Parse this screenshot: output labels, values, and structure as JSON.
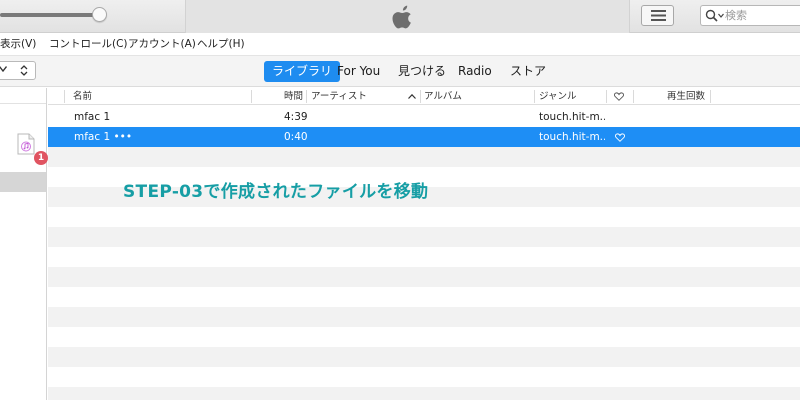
{
  "search": {
    "placeholder": "検索"
  },
  "menu": [
    {
      "label": "表示(V)"
    },
    {
      "label": "コントロール(C)"
    },
    {
      "label": "アカウント(A)"
    },
    {
      "label": "ヘルプ(H)"
    }
  ],
  "nav": {
    "tabs": [
      {
        "label": "ライブラリ",
        "active": true
      },
      {
        "label": "For You"
      },
      {
        "label": "見つける"
      },
      {
        "label": "Radio"
      },
      {
        "label": "ストア"
      }
    ]
  },
  "sidebar": {
    "badge_count": "1"
  },
  "table": {
    "columns": {
      "name": "名前",
      "time": "時間",
      "artist": "アーティスト",
      "album": "アルバム",
      "genre": "ジャンル",
      "plays": "再生回数"
    },
    "rows": [
      {
        "name": "mfac 1",
        "time": "4:39",
        "genre": "touch.hit-m...",
        "selected": false
      },
      {
        "name": "mfac 1 •••",
        "time": "0:40",
        "genre": "touch.hit-m...",
        "selected": true,
        "heart": true
      }
    ]
  },
  "caption": "STEP-03で作成されたファイルを移動",
  "colors": {
    "accent": "#1e8cf0",
    "selected_row": "#1e8ef5",
    "badge": "#e05461",
    "caption": "#169ea5",
    "alt_row": "#f2f2f2"
  },
  "icons": [
    "apple-logo-icon",
    "list-view-icon",
    "search-icon",
    "chevron-down-icon",
    "updown-chevron-icon",
    "music-file-icon",
    "heart-icon",
    "sort-ascending-icon"
  ]
}
